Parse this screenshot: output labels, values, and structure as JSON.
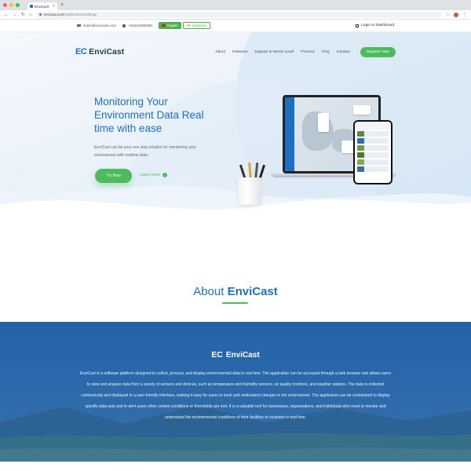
{
  "browser": {
    "tab_title": "EnviCast",
    "tab_close": "×",
    "new_tab": "+",
    "url_domain": "envicast.com",
    "url_path": "/ratelimits/sitesettings",
    "nav_back": "←",
    "nav_forward": "→",
    "nav_reload": "↻",
    "nav_home": "⌂",
    "star": "☆",
    "kebab": "⋮"
  },
  "infobar": {
    "email": "sales@envicast.com",
    "phone": "+62218456090",
    "lang_en": "English",
    "lang_id": "Indonesia",
    "login": "Login to Dashboard"
  },
  "nav": {
    "logo_mark": "EC",
    "logo_text": "EnviCast",
    "items": [
      "About",
      "Features",
      "Support & Servie Level",
      "Process",
      "FAQ",
      "Contact"
    ],
    "register": "Register Now"
  },
  "hero": {
    "title": "Monitoring Your Environment Data Real time with ease",
    "description": "EnviCast can be your one stop solution for monitoring your environment with realtime data.",
    "try_now": "Try Now",
    "learn_more": "Learn more",
    "arrow": "›"
  },
  "about": {
    "heading_prefix": "About ",
    "heading_brand": "EnviCast",
    "logo_mark": "EC",
    "logo_text": "EnviCast",
    "text": "EnviCast is a software platform designed to collect, process, and display environmental data in real time. The application can be accessed through a web browser and allows users to view and analyze data from a variety of sensors and devices, such as temperature and humidity sensors, air quality monitors, and weather stations. The data is collected continuously and displayed in a user-friendly interface, making it easy for users to track and understand changes in the environment. The application can be customized to display specific data sets and to alert users when certain conditions or thresholds are met. It is a valuable tool for businesses, organizations, and individuals who need to monitor and understand the environmental conditions of their facilities or locations in real time."
  },
  "colors": {
    "primary": "#1e6fc1",
    "accent": "#4cbb5c"
  }
}
